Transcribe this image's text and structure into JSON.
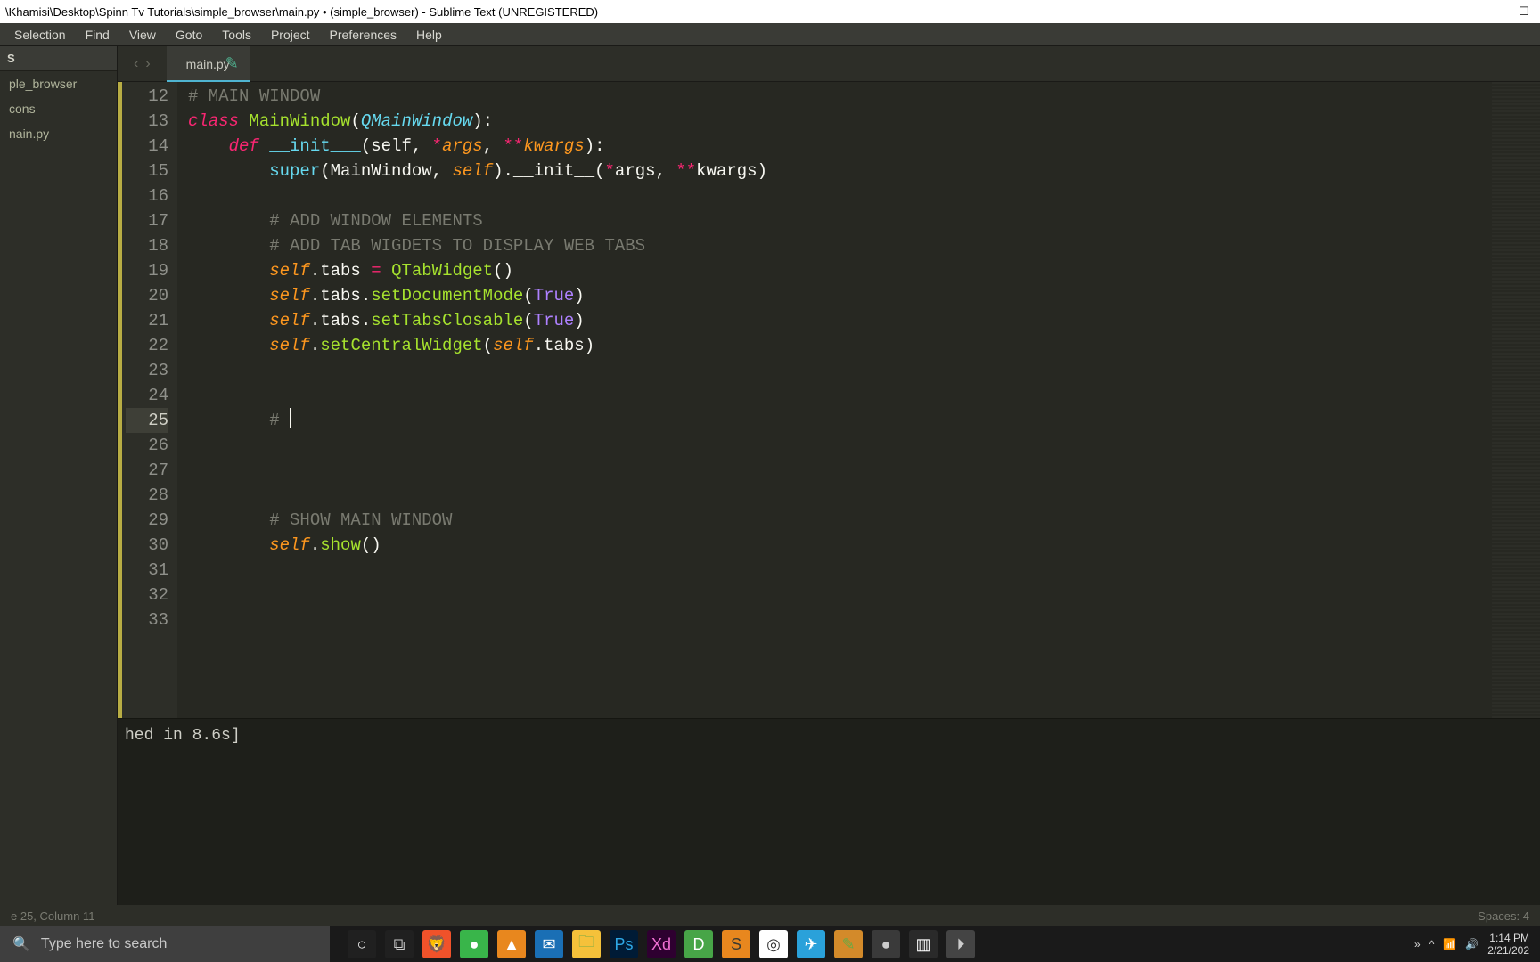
{
  "title": "\\Khamisi\\Desktop\\Spinn Tv Tutorials\\simple_browser\\main.py • (simple_browser) - Sublime Text (UNREGISTERED)",
  "menu": [
    "Selection",
    "Find",
    "View",
    "Goto",
    "Tools",
    "Project",
    "Preferences",
    "Help"
  ],
  "sidebar": {
    "header": "S",
    "items": [
      "ple_browser",
      "cons",
      "nain.py"
    ]
  },
  "tab": {
    "label": "main.py",
    "dirty": "✎"
  },
  "gutter": [
    "12",
    "13",
    "14",
    "15",
    "16",
    "17",
    "18",
    "19",
    "20",
    "21",
    "22",
    "23",
    "24",
    "25",
    "26",
    "27",
    "28",
    "29",
    "30",
    "31",
    "32",
    "33"
  ],
  "current_line_index": 13,
  "code": {
    "l12": "# MAIN WINDOW",
    "l13_kw": "class ",
    "l13_name": "MainWindow",
    "l13_paren": "(",
    "l13_base": "QMainWindow",
    "l13_end": "):",
    "l14_kw": "def ",
    "l14_fn": "__init___",
    "l14_p": "(self, ",
    "l14_a1": "*",
    "l14_a1n": "args",
    "l14_c": ", ",
    "l14_a2": "**",
    "l14_a2n": "kwargs",
    "l14_end": "):",
    "l15_a": "super",
    "l15_b": "(MainWindow, ",
    "l15_c": "self",
    "l15_d": ").",
    "l15_e": "__init__",
    "l15_f": "(",
    "l15_g": "*",
    "l15_gn": "args",
    "l15_h": ", ",
    "l15_i": "**",
    "l15_in": "kwargs",
    "l15_end": ")",
    "l17": "# ADD WINDOW ELEMENTS",
    "l18": "# ADD TAB WIGDETS TO DISPLAY WEB TABS",
    "l19_a": "self",
    "l19_b": ".tabs ",
    "l19_eq": "= ",
    "l19_c": "QTabWidget",
    "l19_d": "()",
    "l20_a": "self",
    "l20_b": ".tabs.",
    "l20_c": "setDocumentMode",
    "l20_d": "(",
    "l20_e": "True",
    "l20_f": ")",
    "l21_a": "self",
    "l21_b": ".tabs.",
    "l21_c": "setTabsClosable",
    "l21_d": "(",
    "l21_e": "True",
    "l21_f": ")",
    "l22_a": "self",
    "l22_b": ".",
    "l22_c": "setCentralWidget",
    "l22_d": "(",
    "l22_e": "self",
    "l22_f": ".tabs)",
    "l25": "# ",
    "l29": "# SHOW MAIN WINDOW",
    "l30_a": "self",
    "l30_b": ".",
    "l30_c": "show",
    "l30_d": "()"
  },
  "console": "hed in 8.6s]",
  "status": {
    "left": "e 25, Column 11",
    "right": "Spaces: 4"
  },
  "taskbar": {
    "search": "Type here to search",
    "tray_up": "^",
    "time": "1:14 PM",
    "date": "2/21/202"
  },
  "apps": [
    {
      "bg": "#202020",
      "fg": "#fff",
      "txt": "○"
    },
    {
      "bg": "#202020",
      "fg": "#ccc",
      "txt": "⧉"
    },
    {
      "bg": "#f0522a",
      "fg": "#fff",
      "txt": "🦁"
    },
    {
      "bg": "#39b54a",
      "fg": "#fff",
      "txt": "●"
    },
    {
      "bg": "#e8871e",
      "fg": "#fff",
      "txt": "▲"
    },
    {
      "bg": "#1a6fb5",
      "fg": "#fff",
      "txt": "✉"
    },
    {
      "bg": "#f5c13a",
      "fg": "#7a4",
      "txt": "🗀"
    },
    {
      "bg": "#001b36",
      "fg": "#2ea8e6",
      "txt": "Ps"
    },
    {
      "bg": "#2e0030",
      "fg": "#f070d3",
      "txt": "Xd"
    },
    {
      "bg": "#47a547",
      "fg": "#fff",
      "txt": "D"
    },
    {
      "bg": "#e8871e",
      "fg": "#3a3a32",
      "txt": "S"
    },
    {
      "bg": "#ffffff",
      "fg": "#333",
      "txt": "◎"
    },
    {
      "bg": "#2aa1da",
      "fg": "#fff",
      "txt": "✈"
    },
    {
      "bg": "#d38a2a",
      "fg": "#6a4",
      "txt": "✎"
    },
    {
      "bg": "#3a3a3a",
      "fg": "#ccc",
      "txt": "●"
    },
    {
      "bg": "#2a2a2a",
      "fg": "#fff",
      "txt": "▥"
    },
    {
      "bg": "#444",
      "fg": "#ccc",
      "txt": "⏵"
    }
  ]
}
